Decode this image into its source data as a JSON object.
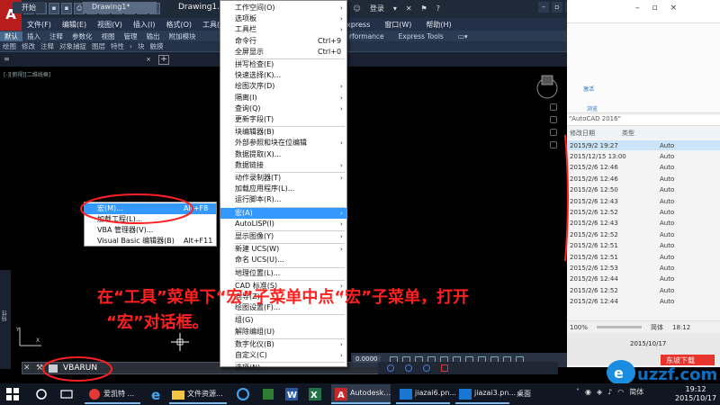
{
  "app": {
    "doc_title": "Drawing1.d...",
    "login_label": "登录",
    "login_icon": "user-icon"
  },
  "menubar": {
    "items": [
      "文件(F)",
      "编辑(E)",
      "视图(V)",
      "插入(I)",
      "格式(O)",
      "工具(T)"
    ],
    "right_items": [
      "Express",
      "窗口(W)",
      "帮助(H)"
    ]
  },
  "ribbon": {
    "tabs": [
      "默认",
      "插入",
      "注释",
      "参数化",
      "视图",
      "管理",
      "输出",
      "附加模块"
    ],
    "right_tabs": [
      "rformance",
      "Express Tools"
    ],
    "panels": [
      "绘图",
      "修改",
      "注释",
      "对象捕捉",
      "图层",
      "特性",
      "块",
      "触摸"
    ]
  },
  "doc_tabs": {
    "start": "开始",
    "drawing": "Drawing1*",
    "add": "+"
  },
  "viewport_label": "[-][俯视][二维线框]",
  "left_palette_label": "特性",
  "tools_menu": {
    "items": [
      {
        "label": "工作空间(O)",
        "shortcut": "",
        "arrow": "›",
        "highlight": false
      },
      {
        "label": "选项板",
        "shortcut": "",
        "arrow": "›",
        "highlight": false
      },
      {
        "label": "工具栏",
        "shortcut": "",
        "arrow": "›",
        "highlight": false
      },
      {
        "label": "命令行",
        "shortcut": "Ctrl+9",
        "arrow": "",
        "highlight": false
      },
      {
        "label": "全屏显示",
        "shortcut": "Ctrl+0",
        "arrow": "",
        "highlight": false
      },
      {
        "label": "拼写检查(E)",
        "shortcut": "",
        "arrow": "",
        "highlight": false
      },
      {
        "label": "快速选择(K)...",
        "shortcut": "",
        "arrow": "",
        "highlight": false
      },
      {
        "label": "绘图次序(D)",
        "shortcut": "",
        "arrow": "›",
        "highlight": false
      },
      {
        "label": "隔离(I)",
        "shortcut": "",
        "arrow": "›",
        "highlight": false
      },
      {
        "label": "查询(Q)",
        "shortcut": "",
        "arrow": "›",
        "highlight": false
      },
      {
        "label": "更新字段(T)",
        "shortcut": "",
        "arrow": "",
        "highlight": false
      },
      {
        "label": "块编辑器(B)",
        "shortcut": "",
        "arrow": "",
        "highlight": false
      },
      {
        "label": "外部参照和块在位编辑",
        "shortcut": "",
        "arrow": "›",
        "highlight": false
      },
      {
        "label": "数据提取(X)...",
        "shortcut": "",
        "arrow": "",
        "highlight": false
      },
      {
        "label": "数据链接",
        "shortcut": "",
        "arrow": "›",
        "highlight": false
      },
      {
        "label": "动作录制器(T)",
        "shortcut": "",
        "arrow": "›",
        "highlight": false
      },
      {
        "label": "加载应用程序(L)...",
        "shortcut": "",
        "arrow": "",
        "highlight": false
      },
      {
        "label": "运行脚本(R)...",
        "shortcut": "",
        "arrow": "",
        "highlight": false
      },
      {
        "label": "宏(A)",
        "shortcut": "",
        "arrow": "›",
        "highlight": true
      },
      {
        "label": "AutoLISP(I)",
        "shortcut": "",
        "arrow": "›",
        "highlight": false
      },
      {
        "label": "显示图像(Y)",
        "shortcut": "",
        "arrow": "›",
        "highlight": false
      },
      {
        "label": "新建 UCS(W)",
        "shortcut": "",
        "arrow": "›",
        "highlight": false
      },
      {
        "label": "命名 UCS(U)...",
        "shortcut": "",
        "arrow": "",
        "highlight": false
      },
      {
        "label": "地理位置(L)...",
        "shortcut": "",
        "arrow": "",
        "highlight": false
      },
      {
        "label": "CAD 标准(S)",
        "shortcut": "",
        "arrow": "›",
        "highlight": false
      },
      {
        "label": "向导(Z)",
        "shortcut": "",
        "arrow": "›",
        "highlight": false
      },
      {
        "label": "绘图设置(F)...",
        "shortcut": "",
        "arrow": "",
        "highlight": false
      },
      {
        "label": "组(G)",
        "shortcut": "",
        "arrow": "",
        "highlight": false
      },
      {
        "label": "解除编组(U)",
        "shortcut": "",
        "arrow": "",
        "highlight": false
      },
      {
        "label": "数字化仪(B)",
        "shortcut": "",
        "arrow": "›",
        "highlight": false
      },
      {
        "label": "自定义(C)",
        "shortcut": "",
        "arrow": "›",
        "highlight": false
      },
      {
        "label": "选项(N)...",
        "shortcut": "",
        "arrow": "",
        "highlight": false
      }
    ]
  },
  "macro_menu": {
    "items": [
      {
        "label": "宏(M)...",
        "shortcut": "Alt+F8",
        "highlight": true
      },
      {
        "label": "加载工程(L)...",
        "shortcut": "",
        "highlight": false
      },
      {
        "label": "VBA 管理器(V)...",
        "shortcut": "",
        "highlight": false
      },
      {
        "label": "Visual Basic 编辑器(B)",
        "shortcut": "Alt+F11",
        "highlight": false
      }
    ]
  },
  "command_line": {
    "text": "VBARUN"
  },
  "status": {
    "coord": "0.0000"
  },
  "annotation": {
    "line1": "在“工具”菜单下“宏”子菜单中点“宏”子菜单，打开",
    "line2": "“宏”对话框。",
    "color": "#ff2020"
  },
  "explorer": {
    "ribbon_labels": [
      "激活",
      "浏览"
    ],
    "search_text": "\"AutoCAD 2016\"",
    "col_date": "修改日期",
    "col_type": "类型",
    "rows": [
      {
        "date": "2015/9/2 19:27",
        "type": "Auto"
      },
      {
        "date": "2015/12/15 13:00",
        "type": "Auto"
      },
      {
        "date": "2015/2/6 12:46",
        "type": "Auto"
      },
      {
        "date": "2015/2/6 12:46",
        "type": "Auto"
      },
      {
        "date": "2015/2/6 12:50",
        "type": "Auto"
      },
      {
        "date": "2015/2/6 12:43",
        "type": "Auto"
      },
      {
        "date": "2015/2/6 12:52",
        "type": "Auto"
      },
      {
        "date": "2015/2/6 12:43",
        "type": "Auto"
      },
      {
        "date": "2015/2/6 12:52",
        "type": "Auto"
      },
      {
        "date": "2015/2/6 12:51",
        "type": "Auto"
      },
      {
        "date": "2015/2/6 12:51",
        "type": "Auto"
      },
      {
        "date": "2015/2/6 12:53",
        "type": "Auto"
      },
      {
        "date": "2015/2/6 12:44",
        "type": "Auto"
      },
      {
        "date": "2015/2/6 12:52",
        "type": "Auto"
      },
      {
        "date": "2015/2/6 12:44",
        "type": "Auto"
      }
    ],
    "zoom": "100%",
    "status_simplified": "简体",
    "time_top": "18:12",
    "date_top": "2015/10/17",
    "watermark_brand": "uzzf.com",
    "watermark_sub": "东坡下载"
  },
  "taskbar": {
    "apps": [
      {
        "label": "爱凯特 ...",
        "icon": "aikaite-icon"
      },
      {
        "label": "文件资源...",
        "icon": "folder-icon"
      },
      {
        "label": "Autodesk...",
        "icon": "autocad-icon"
      },
      {
        "label": "jiazai6.pn...",
        "icon": "image-viewer-icon"
      },
      {
        "label": "jiazai3.pn...",
        "icon": "image-viewer-icon"
      }
    ],
    "desktop_label": "桌面",
    "ime_label": "简体",
    "clock_time": "19:12",
    "clock_date": "2015/10/17"
  }
}
